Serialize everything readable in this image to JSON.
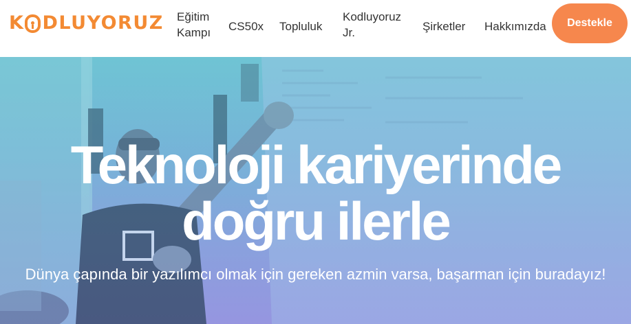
{
  "brand": {
    "logo_k": "K",
    "logo_rest": "DLUYORUZ",
    "logo_text": "KODLUYORUZ",
    "color": "#f38a33"
  },
  "nav": {
    "items": [
      {
        "label": "Eğitim Kampı"
      },
      {
        "label": "CS50x"
      },
      {
        "label": "Topluluk"
      },
      {
        "label": "Kodluyoruz Jr."
      },
      {
        "label": "Şirketler"
      },
      {
        "label": "Hakkımızda"
      }
    ],
    "cta": {
      "label": "Destekle",
      "color": "#f6874d"
    }
  },
  "hero": {
    "title": "Teknoloji kariyerinde doğru ilerle",
    "subtitle": "Dünya çapında bir yazılımcı olmak için gereken azmin varsa, başarman için buradayız!"
  }
}
